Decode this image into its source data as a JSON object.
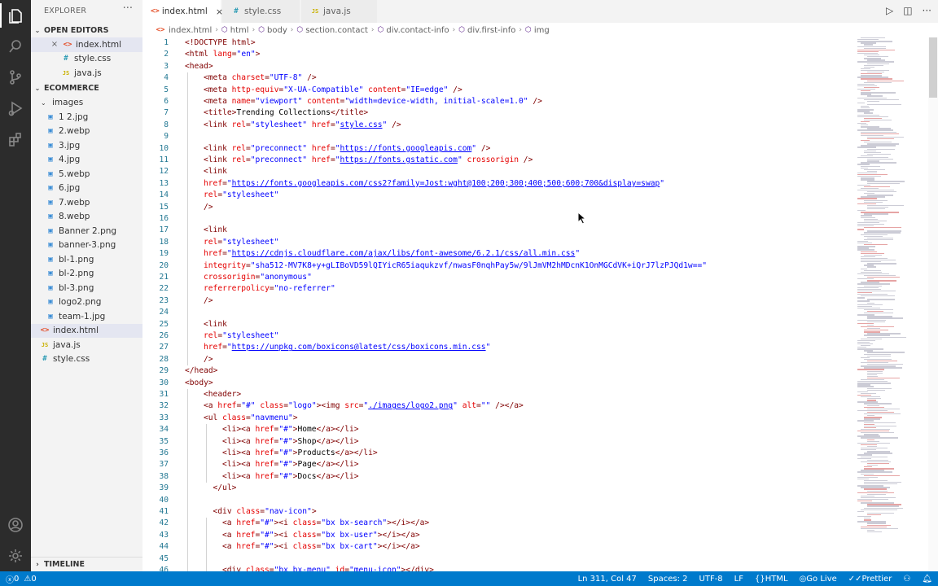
{
  "activity_bar": {
    "top": [
      "explorer-icon",
      "search-icon",
      "source-control-icon",
      "run-debug-icon",
      "extensions-icon"
    ],
    "bottom": [
      "account-icon",
      "settings-gear-icon"
    ]
  },
  "sidebar": {
    "title": "EXPLORER",
    "more": "···",
    "open_editors_label": "OPEN EDITORS",
    "open_editors": [
      {
        "name": "index.html",
        "type": "html",
        "selected": true,
        "close": "×"
      },
      {
        "name": "style.css",
        "type": "css"
      },
      {
        "name": "java.js",
        "type": "js"
      }
    ],
    "project_label": "ECOMMERCE",
    "folder_label": "images",
    "images": [
      "1 2.jpg",
      "2.webp",
      "3.jpg",
      "4.jpg",
      "5.webp",
      "6.jpg",
      "7.webp",
      "8.webp",
      "Banner 2.png",
      "banner-3.png",
      "bl-1.png",
      "bl-2.png",
      "bl-3.png",
      "logo2.png",
      "team-1.jpg"
    ],
    "root_files": [
      {
        "name": "index.html",
        "type": "html",
        "selected": true
      },
      {
        "name": "java.js",
        "type": "js"
      },
      {
        "name": "style.css",
        "type": "css"
      }
    ],
    "timeline_label": "TIMELINE"
  },
  "tabs": [
    {
      "label": "index.html",
      "type": "html",
      "active": true,
      "close": "×"
    },
    {
      "label": "style.css",
      "type": "css"
    },
    {
      "label": "java.js",
      "type": "js"
    }
  ],
  "tab_actions": {
    "run": "▷",
    "split": "◫",
    "more": "···"
  },
  "breadcrumb": [
    "index.html",
    "html",
    "body",
    "section.contact",
    "div.contact-info",
    "div.first-info",
    "img"
  ],
  "icon_glyphs": {
    "html": "<>",
    "css": "#",
    "js": "JS",
    "img": "▣",
    "chevron_down": "⌄",
    "chevron_right": "›"
  },
  "code_lines": [
    {
      "n": "1",
      "i": 0,
      "s": [
        [
          "t",
          "<!DOCTYPE html>"
        ]
      ]
    },
    {
      "n": "2",
      "i": 0,
      "s": [
        [
          "t",
          "<html "
        ],
        [
          "a",
          "lang"
        ],
        [
          "p",
          "="
        ],
        [
          "v",
          "\"en\""
        ],
        [
          "t",
          ">"
        ]
      ]
    },
    {
      "n": "3",
      "i": 0,
      "s": [
        [
          "t",
          "<head>"
        ]
      ]
    },
    {
      "n": "4",
      "i": 1,
      "s": [
        [
          "t",
          "<meta "
        ],
        [
          "a",
          "charset"
        ],
        [
          "p",
          "="
        ],
        [
          "v",
          "\"UTF-8\""
        ],
        [
          "t",
          " />"
        ]
      ]
    },
    {
      "n": "5",
      "i": 1,
      "s": [
        [
          "t",
          "<meta "
        ],
        [
          "a",
          "http-equiv"
        ],
        [
          "p",
          "="
        ],
        [
          "v",
          "\"X-UA-Compatible\""
        ],
        [
          "a",
          " content"
        ],
        [
          "p",
          "="
        ],
        [
          "v",
          "\"IE=edge\""
        ],
        [
          "t",
          " />"
        ]
      ]
    },
    {
      "n": "6",
      "i": 1,
      "s": [
        [
          "t",
          "<meta "
        ],
        [
          "a",
          "name"
        ],
        [
          "p",
          "="
        ],
        [
          "v",
          "\"viewport\""
        ],
        [
          "a",
          " content"
        ],
        [
          "p",
          "="
        ],
        [
          "v",
          "\"width=device-width, initial-scale=1.0\""
        ],
        [
          "t",
          " />"
        ]
      ]
    },
    {
      "n": "7",
      "i": 1,
      "s": [
        [
          "t",
          "<title>"
        ],
        [
          "x",
          "Trending Collections"
        ],
        [
          "t",
          "</title>"
        ]
      ]
    },
    {
      "n": "8",
      "i": 1,
      "s": [
        [
          "t",
          "<link "
        ],
        [
          "a",
          "rel"
        ],
        [
          "p",
          "="
        ],
        [
          "v",
          "\"stylesheet\""
        ],
        [
          "a",
          " href"
        ],
        [
          "p",
          "="
        ],
        [
          "v",
          "\""
        ],
        [
          "u",
          "style.css"
        ],
        [
          "v",
          "\""
        ],
        [
          "t",
          " />"
        ]
      ]
    },
    {
      "n": "9",
      "i": 1,
      "s": []
    },
    {
      "n": "10",
      "i": 1,
      "s": [
        [
          "t",
          "<link "
        ],
        [
          "a",
          "rel"
        ],
        [
          "p",
          "="
        ],
        [
          "v",
          "\"preconnect\""
        ],
        [
          "a",
          " href"
        ],
        [
          "p",
          "="
        ],
        [
          "v",
          "\""
        ],
        [
          "u",
          "https://fonts.googleapis.com"
        ],
        [
          "v",
          "\""
        ],
        [
          "t",
          " />"
        ]
      ]
    },
    {
      "n": "11",
      "i": 1,
      "s": [
        [
          "t",
          "<link "
        ],
        [
          "a",
          "rel"
        ],
        [
          "p",
          "="
        ],
        [
          "v",
          "\"preconnect\""
        ],
        [
          "a",
          " href"
        ],
        [
          "p",
          "="
        ],
        [
          "v",
          "\""
        ],
        [
          "u",
          "https://fonts.gstatic.com"
        ],
        [
          "v",
          "\""
        ],
        [
          "a",
          " crossorigin"
        ],
        [
          "t",
          " />"
        ]
      ]
    },
    {
      "n": "12",
      "i": 1,
      "s": [
        [
          "t",
          "<link"
        ]
      ]
    },
    {
      "n": "13",
      "i": 1,
      "s": [
        [
          "a",
          "href"
        ],
        [
          "p",
          "="
        ],
        [
          "v",
          "\""
        ],
        [
          "u",
          "https://fonts.googleapis.com/css2?family=Jost:wght@100;200;300;400;500;600;700&display=swap"
        ],
        [
          "v",
          "\""
        ]
      ]
    },
    {
      "n": "14",
      "i": 1,
      "s": [
        [
          "a",
          "rel"
        ],
        [
          "p",
          "="
        ],
        [
          "v",
          "\"stylesheet\""
        ]
      ]
    },
    {
      "n": "15",
      "i": 1,
      "s": [
        [
          "t",
          "/>"
        ]
      ]
    },
    {
      "n": "16",
      "i": 1,
      "s": []
    },
    {
      "n": "17",
      "i": 1,
      "s": [
        [
          "t",
          "<link"
        ]
      ]
    },
    {
      "n": "18",
      "i": 1,
      "s": [
        [
          "a",
          "rel"
        ],
        [
          "p",
          "="
        ],
        [
          "v",
          "\"stylesheet\""
        ]
      ]
    },
    {
      "n": "19",
      "i": 1,
      "s": [
        [
          "a",
          "href"
        ],
        [
          "p",
          "="
        ],
        [
          "v",
          "\""
        ],
        [
          "u",
          "https://cdnjs.cloudflare.com/ajax/libs/font-awesome/6.2.1/css/all.min.css"
        ],
        [
          "v",
          "\""
        ]
      ]
    },
    {
      "n": "20",
      "i": 1,
      "s": [
        [
          "a",
          "integrity"
        ],
        [
          "p",
          "="
        ],
        [
          "v",
          "\"sha512-MV7K8+y+gLIBoVD59lQIYicR65iaqukzvf/nwasF0nqhPay5w/9lJmVM2hMDcnK1OnMGCdVK+iQrJ7lzPJQd1w==\""
        ]
      ]
    },
    {
      "n": "21",
      "i": 1,
      "s": [
        [
          "a",
          "crossorigin"
        ],
        [
          "p",
          "="
        ],
        [
          "v",
          "\"anonymous\""
        ]
      ]
    },
    {
      "n": "22",
      "i": 1,
      "s": [
        [
          "a",
          "referrerpolicy"
        ],
        [
          "p",
          "="
        ],
        [
          "v",
          "\"no-referrer\""
        ]
      ]
    },
    {
      "n": "23",
      "i": 1,
      "s": [
        [
          "t",
          "/>"
        ]
      ]
    },
    {
      "n": "24",
      "i": 1,
      "s": []
    },
    {
      "n": "25",
      "i": 1,
      "s": [
        [
          "t",
          "<link"
        ]
      ]
    },
    {
      "n": "26",
      "i": 1,
      "s": [
        [
          "a",
          "rel"
        ],
        [
          "p",
          "="
        ],
        [
          "v",
          "\"stylesheet\""
        ]
      ]
    },
    {
      "n": "27",
      "i": 1,
      "s": [
        [
          "a",
          "href"
        ],
        [
          "p",
          "="
        ],
        [
          "v",
          "\""
        ],
        [
          "u",
          "https://unpkg.com/boxicons@latest/css/boxicons.min.css"
        ],
        [
          "v",
          "\""
        ]
      ]
    },
    {
      "n": "28",
      "i": 1,
      "s": [
        [
          "t",
          "/>"
        ]
      ]
    },
    {
      "n": "29",
      "i": 0,
      "s": [
        [
          "t",
          "</head>"
        ]
      ]
    },
    {
      "n": "30",
      "i": 0,
      "s": [
        [
          "t",
          "<body>"
        ]
      ]
    },
    {
      "n": "31",
      "i": 1,
      "s": [
        [
          "t",
          "<header>"
        ]
      ]
    },
    {
      "n": "32",
      "i": 1,
      "s": [
        [
          "t",
          "<a "
        ],
        [
          "a",
          "href"
        ],
        [
          "p",
          "="
        ],
        [
          "v",
          "\"#\""
        ],
        [
          "a",
          " class"
        ],
        [
          "p",
          "="
        ],
        [
          "v",
          "\"logo\""
        ],
        [
          "t",
          "><img "
        ],
        [
          "a",
          "src"
        ],
        [
          "p",
          "="
        ],
        [
          "v",
          "\""
        ],
        [
          "u",
          "./images/logo2.png"
        ],
        [
          "v",
          "\""
        ],
        [
          "a",
          " alt"
        ],
        [
          "p",
          "="
        ],
        [
          "v",
          "\"\""
        ],
        [
          "t",
          " /></a>"
        ]
      ]
    },
    {
      "n": "33",
      "i": 1,
      "s": [
        [
          "t",
          "<ul "
        ],
        [
          "a",
          "class"
        ],
        [
          "p",
          "="
        ],
        [
          "v",
          "\"navmenu\""
        ],
        [
          "t",
          ">"
        ]
      ]
    },
    {
      "n": "34",
      "i": 2,
      "s": [
        [
          "t",
          "<li><a "
        ],
        [
          "a",
          "href"
        ],
        [
          "p",
          "="
        ],
        [
          "v",
          "\"#\""
        ],
        [
          "t",
          ">"
        ],
        [
          "x",
          "Home"
        ],
        [
          "t",
          "</a></li>"
        ]
      ]
    },
    {
      "n": "35",
      "i": 2,
      "s": [
        [
          "t",
          "<li><a "
        ],
        [
          "a",
          "href"
        ],
        [
          "p",
          "="
        ],
        [
          "v",
          "\"#\""
        ],
        [
          "t",
          ">"
        ],
        [
          "x",
          "Shop"
        ],
        [
          "t",
          "</a></li>"
        ]
      ]
    },
    {
      "n": "36",
      "i": 2,
      "s": [
        [
          "t",
          "<li><a "
        ],
        [
          "a",
          "href"
        ],
        [
          "p",
          "="
        ],
        [
          "v",
          "\"#\""
        ],
        [
          "t",
          ">"
        ],
        [
          "x",
          "Products"
        ],
        [
          "t",
          "</a></li>"
        ]
      ]
    },
    {
      "n": "37",
      "i": 2,
      "s": [
        [
          "t",
          "<li><a "
        ],
        [
          "a",
          "href"
        ],
        [
          "p",
          "="
        ],
        [
          "v",
          "\"#\""
        ],
        [
          "t",
          ">"
        ],
        [
          "x",
          "Page"
        ],
        [
          "t",
          "</a></li>"
        ]
      ]
    },
    {
      "n": "38",
      "i": 2,
      "s": [
        [
          "t",
          "<li><a "
        ],
        [
          "a",
          "href"
        ],
        [
          "p",
          "="
        ],
        [
          "v",
          "\"#\""
        ],
        [
          "t",
          ">"
        ],
        [
          "x",
          "Docs"
        ],
        [
          "t",
          "</a></li>"
        ]
      ]
    },
    {
      "n": "39",
      "i": 1.5,
      "s": [
        [
          "t",
          "</ul>"
        ]
      ]
    },
    {
      "n": "40",
      "i": 1,
      "s": []
    },
    {
      "n": "41",
      "i": 1.5,
      "s": [
        [
          "t",
          "<div "
        ],
        [
          "a",
          "class"
        ],
        [
          "p",
          "="
        ],
        [
          "v",
          "\"nav-icon\""
        ],
        [
          "t",
          ">"
        ]
      ]
    },
    {
      "n": "42",
      "i": 2,
      "s": [
        [
          "t",
          "<a "
        ],
        [
          "a",
          "href"
        ],
        [
          "p",
          "="
        ],
        [
          "v",
          "\"#\""
        ],
        [
          "t",
          "><i "
        ],
        [
          "a",
          "class"
        ],
        [
          "p",
          "="
        ],
        [
          "v",
          "\"bx bx-search\""
        ],
        [
          "t",
          "></i></a>"
        ]
      ]
    },
    {
      "n": "43",
      "i": 2,
      "s": [
        [
          "t",
          "<a "
        ],
        [
          "a",
          "href"
        ],
        [
          "p",
          "="
        ],
        [
          "v",
          "\"#\""
        ],
        [
          "t",
          "><i "
        ],
        [
          "a",
          "class"
        ],
        [
          "p",
          "="
        ],
        [
          "v",
          "\"bx bx-user\""
        ],
        [
          "t",
          "></i></a>"
        ]
      ]
    },
    {
      "n": "44",
      "i": 2,
      "s": [
        [
          "t",
          "<a "
        ],
        [
          "a",
          "href"
        ],
        [
          "p",
          "="
        ],
        [
          "v",
          "\"#\""
        ],
        [
          "t",
          "><i "
        ],
        [
          "a",
          "class"
        ],
        [
          "p",
          "="
        ],
        [
          "v",
          "\"bx bx-cart\""
        ],
        [
          "t",
          "></i></a>"
        ]
      ]
    },
    {
      "n": "45",
      "i": 2,
      "s": []
    },
    {
      "n": "46",
      "i": 2,
      "s": [
        [
          "t",
          "<div "
        ],
        [
          "a",
          "class"
        ],
        [
          "p",
          "="
        ],
        [
          "v",
          "\"bx bx-menu\""
        ],
        [
          "a",
          " id"
        ],
        [
          "p",
          "="
        ],
        [
          "v",
          "\"menu-icon\""
        ],
        [
          "t",
          "></div>"
        ]
      ]
    }
  ],
  "statusbar": {
    "errors": "0",
    "warnings": "0",
    "position": "Ln 311, Col 47",
    "spaces": "Spaces: 2",
    "encoding": "UTF-8",
    "eol": "LF",
    "language": "HTML",
    "golive": "Go Live",
    "prettier": "Prettier"
  },
  "colors": {
    "statusbar": "#007acc",
    "activity": "#2c2c2c",
    "sidebar": "#f3f3f3",
    "tag": "#800000",
    "attr": "#e50000",
    "value": "#0000ff"
  }
}
